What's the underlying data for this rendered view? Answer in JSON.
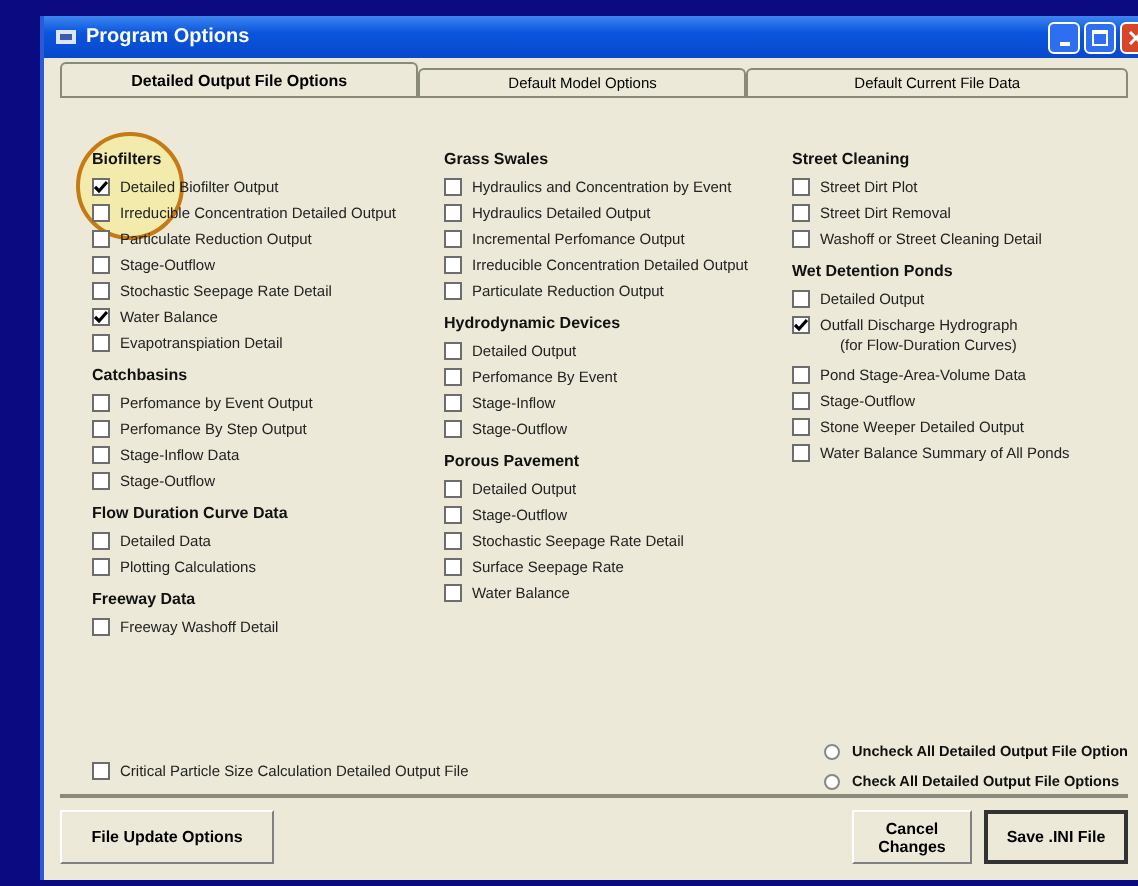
{
  "window": {
    "title": "Program Options"
  },
  "tabs": [
    {
      "label": "Detailed Output File Options",
      "selected": true
    },
    {
      "label": "Default Model Options",
      "selected": false
    },
    {
      "label": "Default Current File Data",
      "selected": false
    }
  ],
  "columns": [
    {
      "sections": [
        {
          "title": "Biofilters",
          "items": [
            {
              "label": "Detailed Biofilter Output",
              "checked": true
            },
            {
              "label": "Irreducible Concentration Detailed Output",
              "checked": false
            },
            {
              "label": "Particulate Reduction Output",
              "checked": false
            },
            {
              "label": "Stage-Outflow",
              "checked": false
            },
            {
              "label": "Stochastic Seepage Rate Detail",
              "checked": false
            },
            {
              "label": "Water Balance",
              "checked": true
            },
            {
              "label": "Evapotranspiation Detail",
              "checked": false
            }
          ]
        },
        {
          "title": "Catchbasins",
          "items": [
            {
              "label": "Perfomance by Event Output",
              "checked": false
            },
            {
              "label": "Perfomance By Step Output",
              "checked": false
            },
            {
              "label": "Stage-Inflow Data",
              "checked": false
            },
            {
              "label": "Stage-Outflow",
              "checked": false
            }
          ]
        },
        {
          "title": "Flow Duration Curve Data",
          "items": [
            {
              "label": "Detailed Data",
              "checked": false
            },
            {
              "label": "Plotting Calculations",
              "checked": false
            }
          ]
        },
        {
          "title": "Freeway Data",
          "items": [
            {
              "label": "Freeway Washoff Detail",
              "checked": false
            }
          ]
        }
      ]
    },
    {
      "sections": [
        {
          "title": "Grass Swales",
          "items": [
            {
              "label": "Hydraulics and Concentration by Event",
              "checked": false
            },
            {
              "label": "Hydraulics Detailed Output",
              "checked": false
            },
            {
              "label": "Incremental Perfomance Output",
              "checked": false
            },
            {
              "label": "Irreducible Concentration Detailed Output",
              "checked": false
            },
            {
              "label": "Particulate Reduction Output",
              "checked": false
            }
          ]
        },
        {
          "title": "Hydrodynamic Devices",
          "items": [
            {
              "label": "Detailed Output",
              "checked": false
            },
            {
              "label": "Perfomance By Event",
              "checked": false
            },
            {
              "label": "Stage-Inflow",
              "checked": false
            },
            {
              "label": "Stage-Outflow",
              "checked": false
            }
          ]
        },
        {
          "title": "Porous Pavement",
          "items": [
            {
              "label": "Detailed Output",
              "checked": false
            },
            {
              "label": "Stage-Outflow",
              "checked": false
            },
            {
              "label": "Stochastic Seepage Rate Detail",
              "checked": false
            },
            {
              "label": "Surface Seepage Rate",
              "checked": false
            },
            {
              "label": "Water Balance",
              "checked": false
            }
          ]
        }
      ]
    },
    {
      "sections": [
        {
          "title": "Street Cleaning",
          "items": [
            {
              "label": "Street Dirt Plot",
              "checked": false
            },
            {
              "label": "Street Dirt Removal",
              "checked": false
            },
            {
              "label": "Washoff or Street Cleaning Detail",
              "checked": false
            }
          ]
        },
        {
          "title": "Wet Detention Ponds",
          "items": [
            {
              "label": "Detailed Output",
              "checked": false
            },
            {
              "label": "Outfall Discharge Hydrograph",
              "note": "(for Flow-Duration Curves)",
              "checked": true
            },
            {
              "label": "Pond Stage-Area-Volume Data",
              "checked": false
            },
            {
              "label": "Stage-Outflow",
              "checked": false
            },
            {
              "label": "Stone Weeper Detailed Output",
              "checked": false
            },
            {
              "label": "Water Balance Summary of All Ponds",
              "checked": false
            }
          ]
        }
      ]
    }
  ],
  "critical": {
    "label": "Critical Particle Size Calculation Detailed Output File",
    "checked": false
  },
  "radios": [
    {
      "label": "Uncheck All Detailed Output File Option",
      "selected": false
    },
    {
      "label": "Check All Detailed Output File Options",
      "selected": false
    }
  ],
  "buttons": {
    "left": "File Update Options",
    "cancel": [
      "Cancel",
      "Changes"
    ],
    "save": "Save .INI File"
  }
}
